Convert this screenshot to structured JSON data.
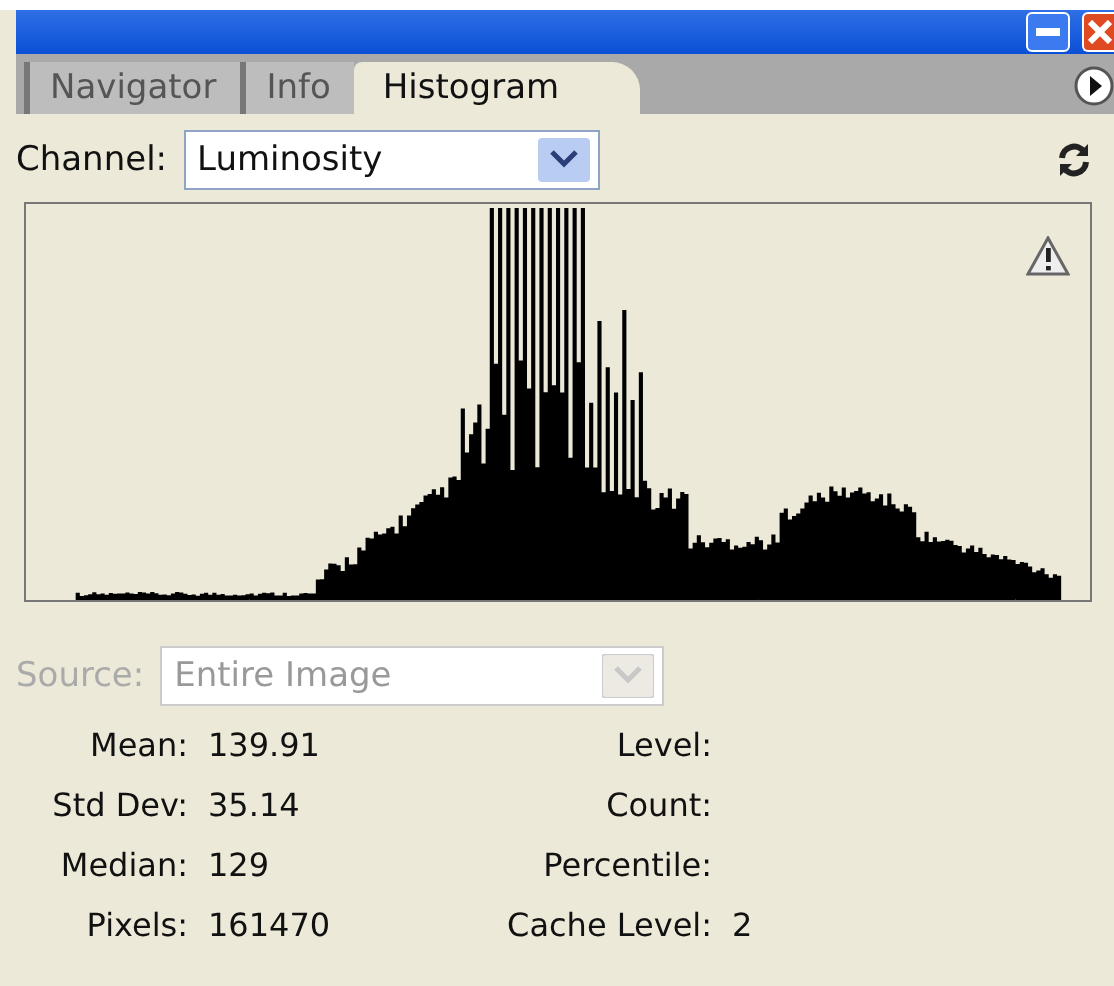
{
  "tabs": [
    {
      "label": "Navigator",
      "selected": false
    },
    {
      "label": "Info",
      "selected": false
    },
    {
      "label": "Histogram",
      "selected": true
    }
  ],
  "channel": {
    "label": "Channel:",
    "value": "Luminosity"
  },
  "source": {
    "label": "Source:",
    "value": "Entire Image",
    "disabled": true
  },
  "stats_left": [
    {
      "label": "Mean:",
      "value": "139.91"
    },
    {
      "label": "Std Dev:",
      "value": "35.14"
    },
    {
      "label": "Median:",
      "value": "129"
    },
    {
      "label": "Pixels:",
      "value": "161470"
    }
  ],
  "stats_right": [
    {
      "label": "Level:"
    },
    {
      "label": "Count:"
    },
    {
      "label": "Percentile:"
    },
    {
      "label": "Cache Level:",
      "value": "2"
    }
  ]
}
